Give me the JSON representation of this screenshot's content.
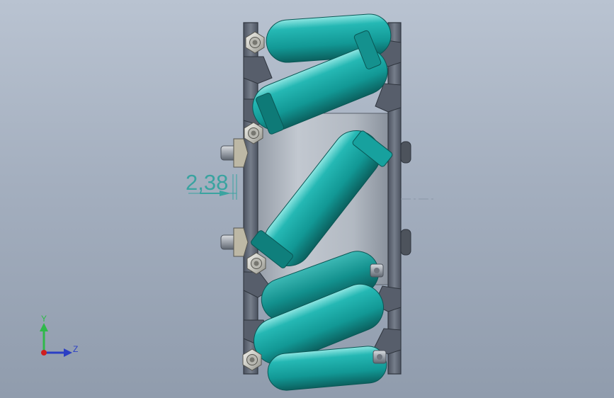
{
  "viewport": {
    "background_top": "#b9c3d1",
    "background_bottom": "#909cad"
  },
  "model": {
    "roller_color": "#1aa5a2",
    "roller_shadow": "#0b6f6c",
    "plate_color": "#5f6775",
    "hub_color": "#a9b0ba",
    "nut_color": "#d7d7d2"
  },
  "dimension": {
    "value": "2,38",
    "color": "#3aa3a0"
  },
  "triad": {
    "y_label": "Y",
    "z_label": "Z",
    "y_color": "#2fb94a",
    "z_color": "#2b3fc4",
    "origin_color": "#d01f1f"
  }
}
